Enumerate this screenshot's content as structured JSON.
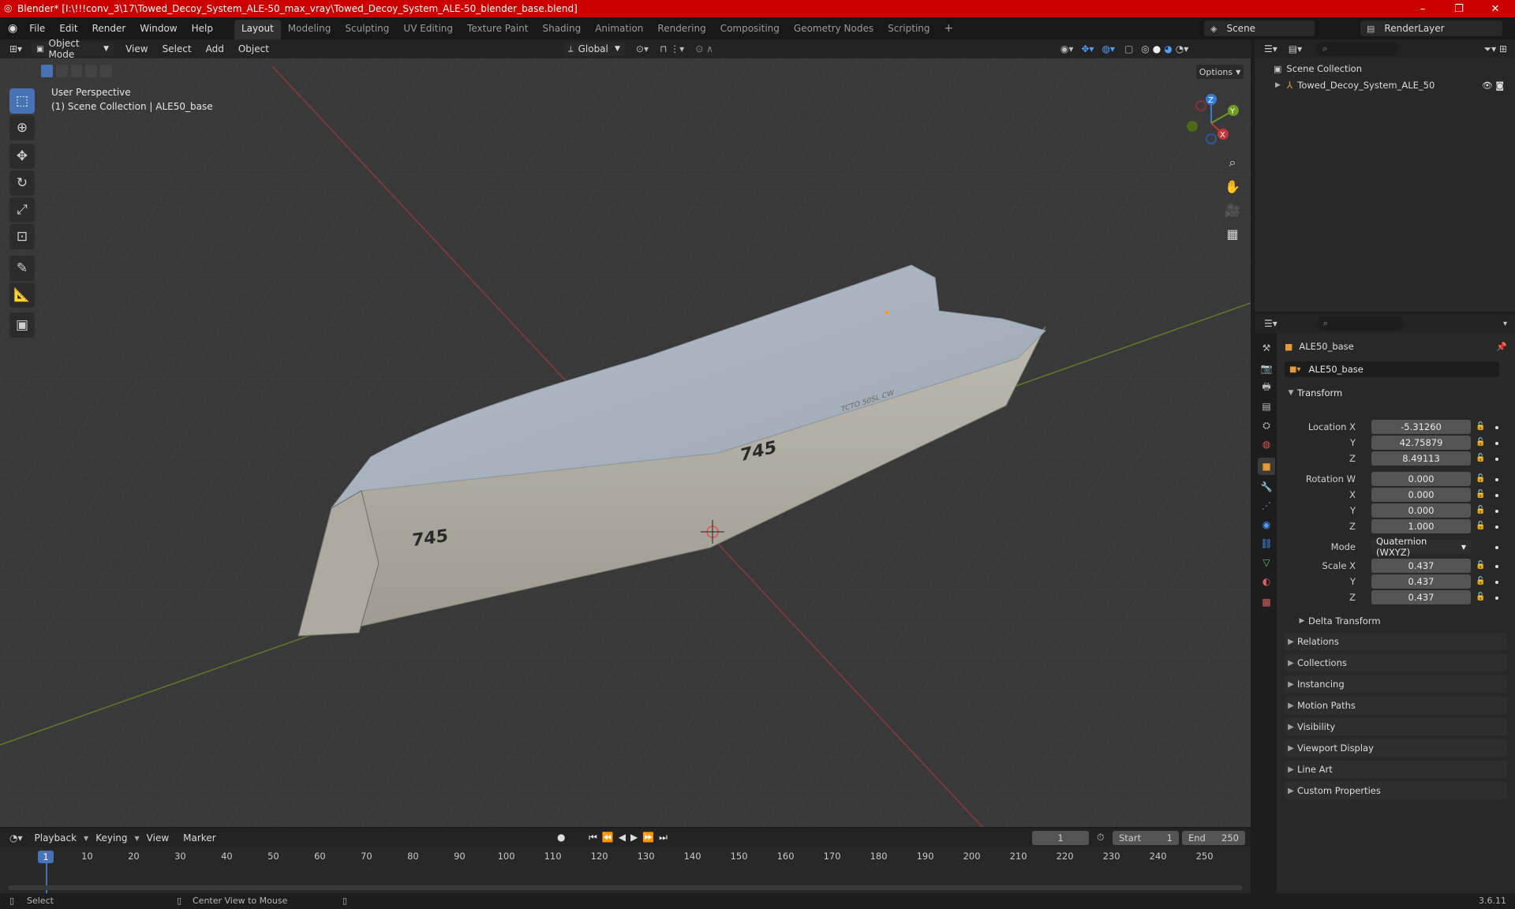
{
  "window": {
    "title": "Blender* [I:\\!!!conv_3\\17\\Towed_Decoy_System_ALE-50_max_vray\\Towed_Decoy_System_ALE-50_blender_base.blend]",
    "min": "–",
    "max": "❐",
    "close": "✕"
  },
  "menu": [
    "File",
    "Edit",
    "Render",
    "Window",
    "Help"
  ],
  "workspaces": [
    "Layout",
    "Modeling",
    "Sculpting",
    "UV Editing",
    "Texture Paint",
    "Shading",
    "Animation",
    "Rendering",
    "Compositing",
    "Geometry Nodes",
    "Scripting"
  ],
  "scene": {
    "label": "Scene",
    "renderlayer": "RenderLayer"
  },
  "viewport_header": {
    "mode": "Object Mode",
    "menus": [
      "View",
      "Select",
      "Add",
      "Object"
    ],
    "orientation": "Global",
    "options": "Options"
  },
  "overlay": {
    "line1": "User Perspective",
    "line2": "(1) Scene Collection | ALE50_base"
  },
  "gizmo": {
    "z": "Z",
    "y": "Y",
    "x": "X"
  },
  "model": {
    "num1": "745",
    "num2": "745",
    "stencil": "TCTO 50SL CW"
  },
  "outliner": {
    "root": "Scene Collection",
    "child": "Towed_Decoy_System_ALE_50"
  },
  "properties": {
    "object_name": "ALE50_base",
    "data_name": "ALE50_base",
    "transform_label": "Transform",
    "location": {
      "label": "Location X",
      "x": "-5.31260",
      "y": "42.75879",
      "z": "8.49113"
    },
    "rotation": {
      "label": "Rotation W",
      "w": "0.000",
      "x": "0.000",
      "y": "0.000",
      "z": "1.000"
    },
    "axis": {
      "x": "X",
      "y": "Y",
      "z": "Z"
    },
    "mode": {
      "label": "Mode",
      "value": "Quaternion (WXYZ)"
    },
    "scale": {
      "label": "Scale X",
      "x": "0.437",
      "y": "0.437",
      "z": "0.437"
    },
    "delta": "Delta Transform",
    "panels": [
      "Relations",
      "Collections",
      "Instancing",
      "Motion Paths",
      "Visibility",
      "Viewport Display",
      "Line Art",
      "Custom Properties"
    ]
  },
  "timeline": {
    "menus": [
      "Playback",
      "Keying",
      "View",
      "Marker"
    ],
    "current": "1",
    "start_label": "Start",
    "start": "1",
    "end_label": "End",
    "end": "250",
    "ticks": [
      "1",
      "10",
      "20",
      "30",
      "40",
      "50",
      "60",
      "70",
      "80",
      "90",
      "100",
      "110",
      "120",
      "130",
      "140",
      "150",
      "160",
      "170",
      "180",
      "190",
      "200",
      "210",
      "220",
      "230",
      "240",
      "250"
    ]
  },
  "status": {
    "select": "Select",
    "center": "Center View to Mouse",
    "version": "3.6.11"
  },
  "colors": {
    "titlebar": "#cc0000",
    "accent": "#4772b3",
    "x_axis": "#c8343c",
    "y_axis": "#6e9a20",
    "z_axis": "#2f7ee0"
  }
}
